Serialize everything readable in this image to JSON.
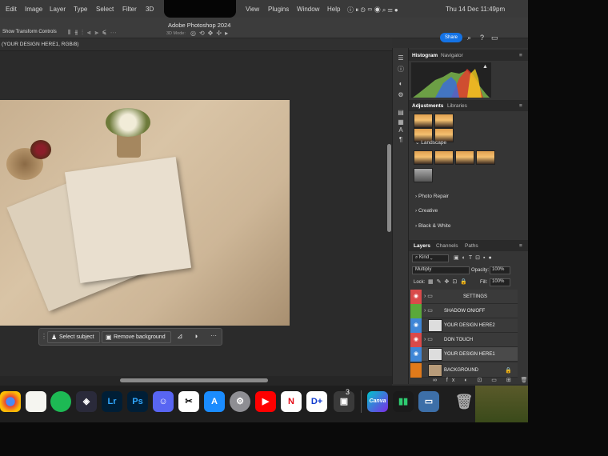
{
  "menubar": {
    "items": [
      "Edit",
      "Image",
      "Layer",
      "Type",
      "Select",
      "Filter",
      "3D"
    ],
    "right_items": [
      "View",
      "Plugins",
      "Window",
      "Help"
    ],
    "clock": "Thu 14 Dec 11:49pm"
  },
  "app": {
    "title": "Adobe Photoshop 2024",
    "options_label": "Show Transform Controls",
    "mode_3d": "3D Mode:",
    "share_label": "Share",
    "doc_tab": "(YOUR DESIGN HERE1, RGB/8)"
  },
  "contextbar": {
    "select_subject": "Select subject",
    "remove_background": "Remove background",
    "more": "···"
  },
  "panels": {
    "histogram_tab": "Histogram",
    "navigator_tab": "Navigator",
    "adjustments_tab": "Adjustments",
    "libraries_tab": "Libraries",
    "landscape": "Landscape",
    "photo_repair": "Photo Repair",
    "creative": "Creative",
    "bw": "Black & White",
    "layers_tab": "Layers",
    "channels_tab": "Channels",
    "paths_tab": "Paths",
    "kind": "Kind",
    "blend_mode": "Multiply",
    "opacity_label": "Opacity:",
    "opacity_value": "100%",
    "lock_label": "Lock:",
    "fill_label": "Fill:",
    "fill_value": "100%"
  },
  "layers": [
    {
      "name": "SETTINGS",
      "color": "#d94a4a",
      "folder": true
    },
    {
      "name": "SHADOW ON/OFF",
      "color": "#5aa83a",
      "folder": true
    },
    {
      "name": "YOUR DESIGN HERE2",
      "color": "#3f86d6",
      "folder": false
    },
    {
      "name": "DON TOUCH",
      "color": "#d94a4a",
      "folder": true
    },
    {
      "name": "YOUR DESIGN HERE1",
      "color": "#3f86d6",
      "folder": false
    },
    {
      "name": "BACKGROUND",
      "color": "#e07a1a",
      "folder": false
    }
  ],
  "dock": {
    "lr": "Lr",
    "ps": "Ps",
    "canva": "Canva",
    "badge": "3"
  },
  "colors": {
    "accent": "#1473e6"
  }
}
